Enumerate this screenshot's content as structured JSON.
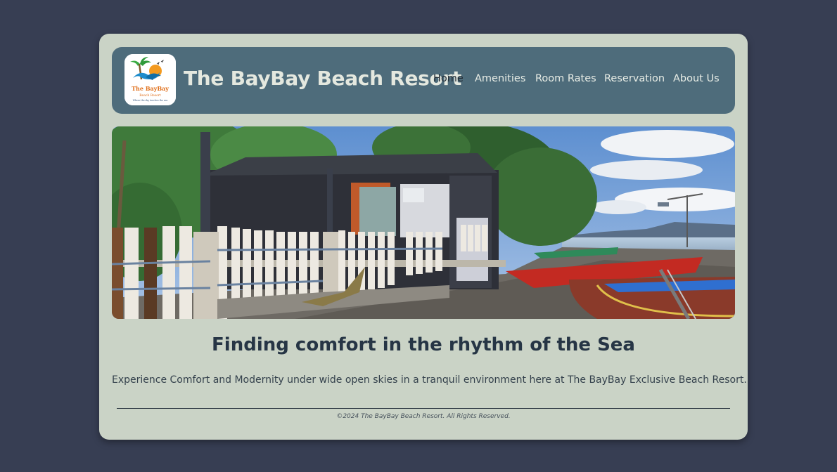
{
  "brand": {
    "name": "The BayBay Beach Resort",
    "logo_text_line1": "The BayBay",
    "logo_text_line2": "Beach Resort",
    "logo_tagline": "Where the sky touches the sea"
  },
  "nav": {
    "items": [
      {
        "label": "Home",
        "active": true
      },
      {
        "label": "Amenities",
        "active": false
      },
      {
        "label": "Room Rates",
        "active": false
      },
      {
        "label": "Reservation",
        "active": false
      },
      {
        "label": "About Us",
        "active": false
      }
    ]
  },
  "hero": {
    "heading": "Finding comfort in the rhythm of the Sea",
    "description": "Experience Comfort and Modernity under wide open skies in a tranquil environment here at The BayBay Exclusive Beach Resort."
  },
  "footer": {
    "copyright": "©2024 The BayBay Beach Resort. All Rights Reserved."
  },
  "colors": {
    "page_background": "#373e53",
    "card_background": "#cad3c6",
    "header_background": "#4e6c7b",
    "heading_text": "#263545"
  }
}
